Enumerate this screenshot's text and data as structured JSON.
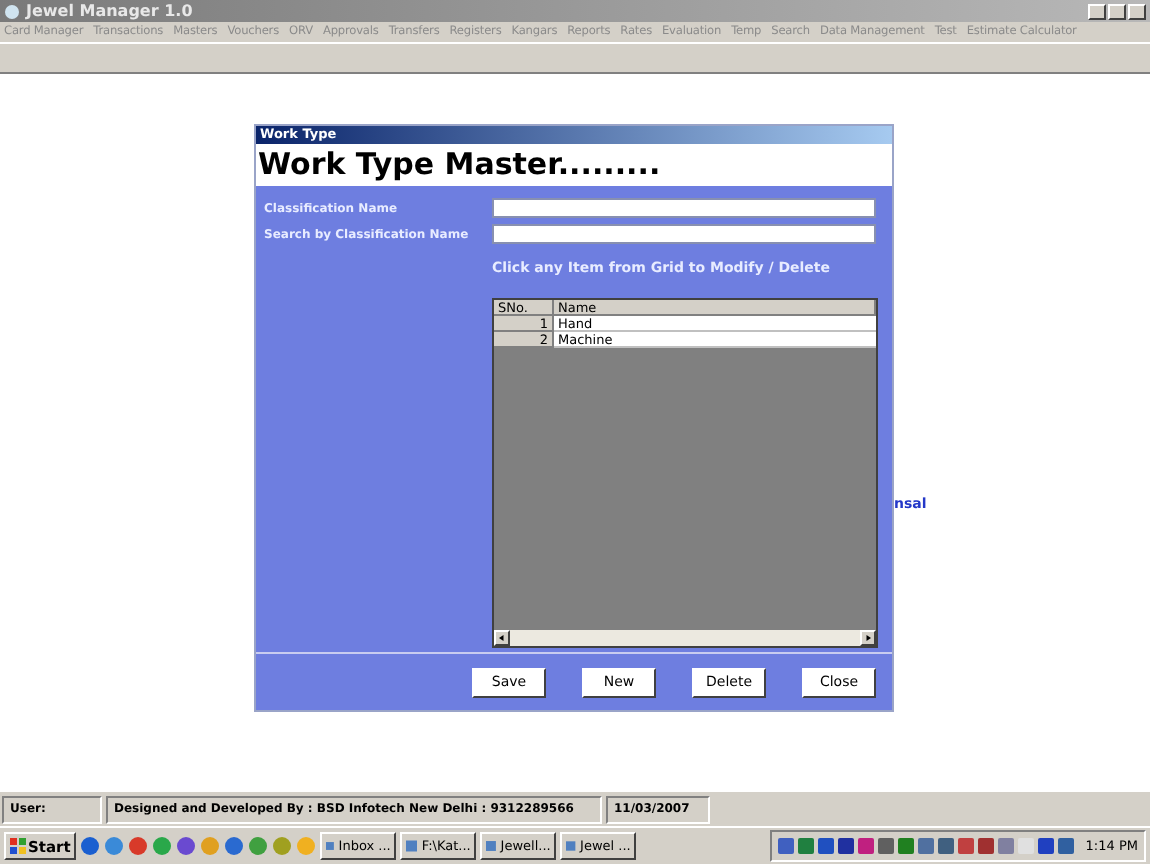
{
  "window": {
    "title": "Jewel Manager 1.0"
  },
  "menu": [
    {
      "label": "Card Manager"
    },
    {
      "label": "Transactions"
    },
    {
      "label": "Masters"
    },
    {
      "label": "Vouchers"
    },
    {
      "label": "ORV"
    },
    {
      "label": "Approvals"
    },
    {
      "label": "Transfers"
    },
    {
      "label": "Registers"
    },
    {
      "label": "Kangars"
    },
    {
      "label": "Reports"
    },
    {
      "label": "Rates"
    },
    {
      "label": "Evaluation"
    },
    {
      "label": "Temp"
    },
    {
      "label": "Search"
    },
    {
      "label": "Data Management"
    },
    {
      "label": "Test"
    },
    {
      "label": "Estimate Calculator"
    }
  ],
  "background_text": "nsal",
  "dialog": {
    "title": "Work Type",
    "heading": "Work Type Master.........",
    "fields": [
      {
        "label": "Classification Name"
      },
      {
        "label": "Search by Classification Name"
      }
    ],
    "hint": "Click any Item from Grid to Modify / Delete",
    "grid": {
      "columns": [
        "SNo.",
        "Name"
      ],
      "rows": [
        [
          "1",
          "Hand"
        ],
        [
          "2",
          "Machine"
        ]
      ]
    },
    "buttons": [
      "Save",
      "New",
      "Delete",
      "Close"
    ]
  },
  "status_bar": {
    "user": "User:",
    "credit": "Designed and Developed By : BSD Infotech New Delhi : 9312289566",
    "date": "11/03/2007"
  },
  "taskbar": {
    "start": "Start",
    "tasks": [
      {
        "label": "Inbox ..."
      },
      {
        "label": "F:\\Kat..."
      },
      {
        "label": "Jewell..."
      },
      {
        "label": "Jewel ..."
      }
    ],
    "clock": "1:14 PM"
  }
}
